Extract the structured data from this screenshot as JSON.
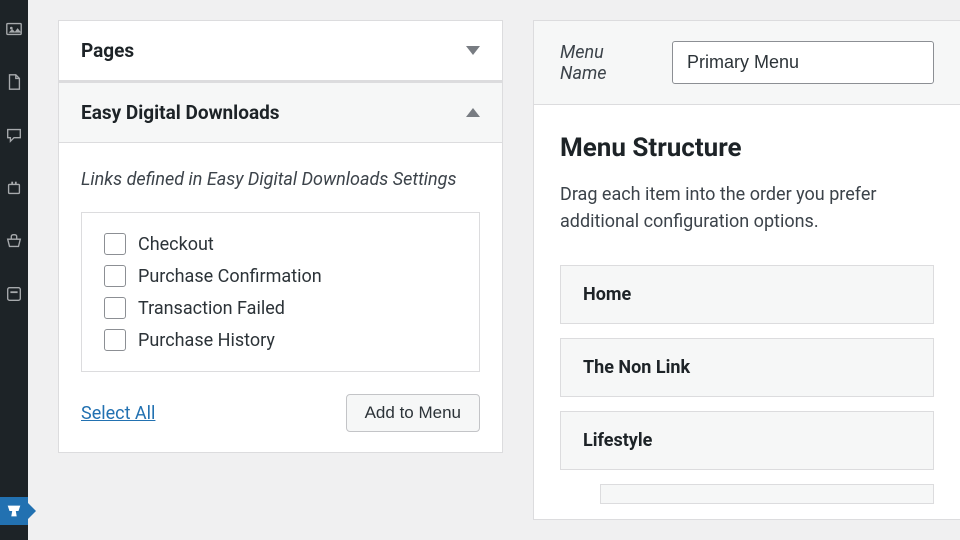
{
  "accordion": {
    "pages": {
      "title": "Pages"
    },
    "edd": {
      "title": "Easy Digital Downloads",
      "description": "Links defined in Easy Digital Downloads Settings",
      "items": [
        "Checkout",
        "Purchase Confirmation",
        "Transaction Failed",
        "Purchase History"
      ],
      "select_all_label": "Select All",
      "add_button_label": "Add to Menu"
    }
  },
  "menu": {
    "name_label": "Menu Name",
    "name_value": "Primary Menu",
    "structure_title": "Menu Structure",
    "structure_desc": "Drag each item into the order you prefer additional configuration options.",
    "items": [
      "Home",
      "The Non Link",
      "Lifestyle"
    ]
  }
}
